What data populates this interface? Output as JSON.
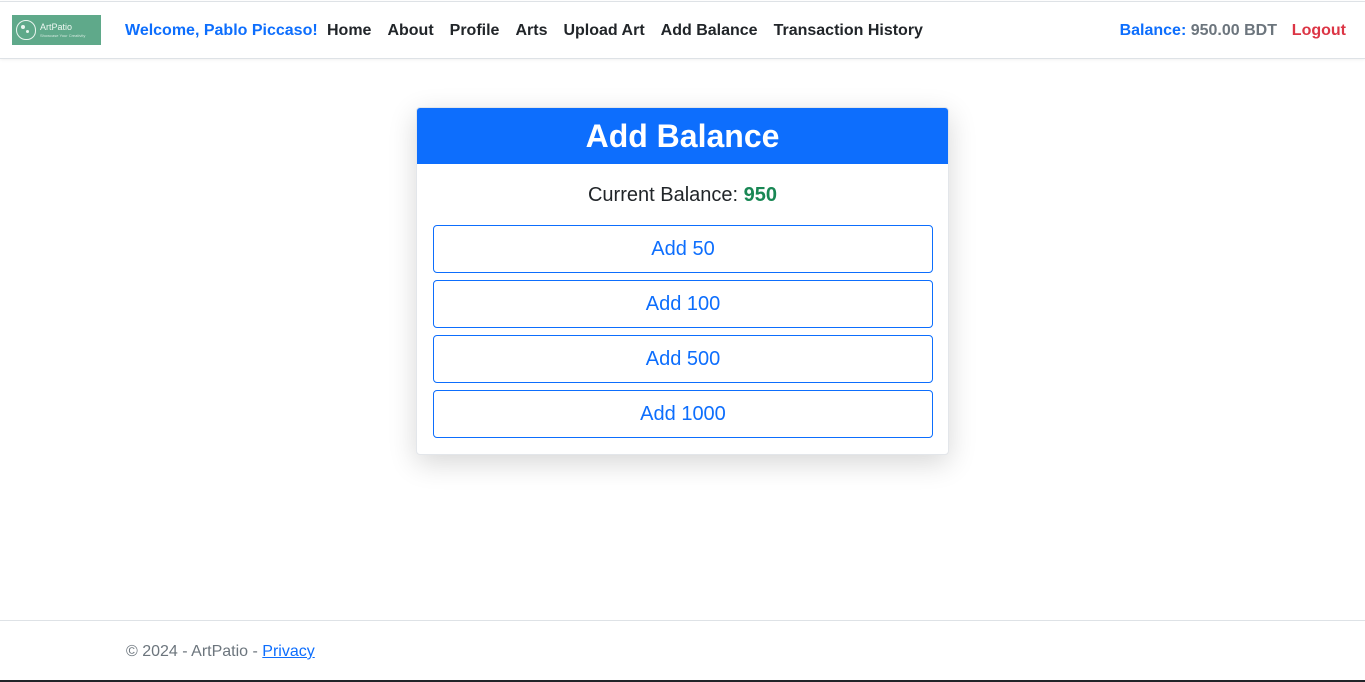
{
  "navbar": {
    "logo": {
      "name": "ArtPatio",
      "tagline": "Showcase Your Creativity",
      "icon": "palette-icon"
    },
    "welcome": "Welcome, Pablo Piccaso!",
    "links": [
      {
        "label": "Home"
      },
      {
        "label": "About"
      },
      {
        "label": "Profile"
      },
      {
        "label": "Arts"
      },
      {
        "label": "Upload Art"
      },
      {
        "label": "Add Balance"
      },
      {
        "label": "Transaction History"
      }
    ],
    "balance_label": "Balance:",
    "balance_value": "950.00 BDT",
    "logout_label": "Logout"
  },
  "card": {
    "title": "Add Balance",
    "current_balance_label": "Current Balance:",
    "current_balance_value": "950",
    "buttons": [
      {
        "label": "Add 50"
      },
      {
        "label": "Add 100"
      },
      {
        "label": "Add 500"
      },
      {
        "label": "Add 1000"
      }
    ]
  },
  "footer": {
    "copyright": "© 2024 - ArtPatio - ",
    "privacy_label": "Privacy"
  },
  "colors": {
    "primary": "#0d6efd",
    "success": "#198754",
    "danger": "#dc3545",
    "muted": "#6c757d",
    "logo_bg": "#5fa98a"
  }
}
